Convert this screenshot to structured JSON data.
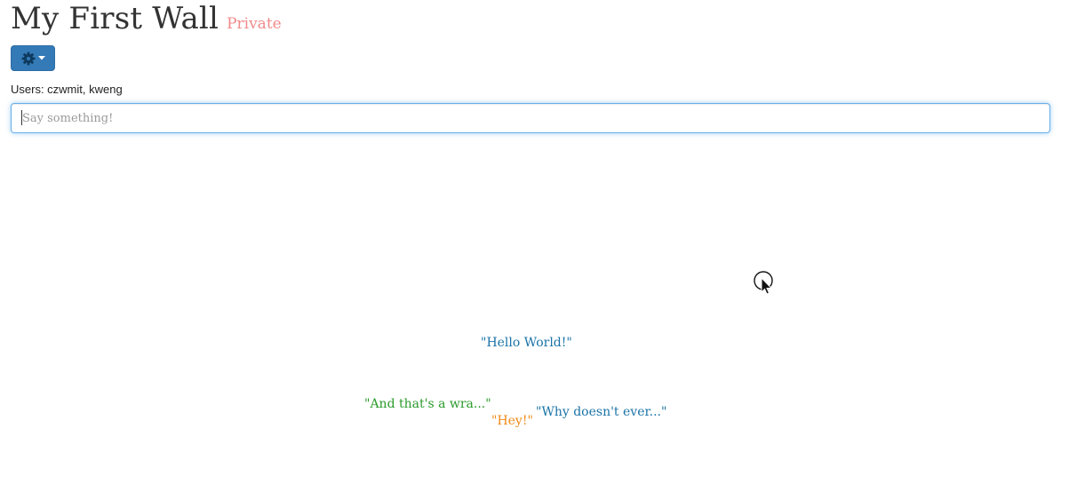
{
  "wall": {
    "title": "My First Wall",
    "privacy": "Private"
  },
  "settings_button": {
    "icon": "gear-icon",
    "dropdown_icon": "caret-down-icon"
  },
  "users": {
    "text": "Users: czwmit, kweng"
  },
  "composer": {
    "placeholder": "Say something!",
    "value": ""
  },
  "posts": [
    {
      "text": "\"Hello World!\"",
      "color": "#1a73a8"
    },
    {
      "text": "\"And that's a wra...\"",
      "color": "#2a9a2a"
    },
    {
      "text": "\"Hey!\"",
      "color": "#f08a16"
    },
    {
      "text": "\"Why doesn't ever...\"",
      "color": "#1a73a8"
    }
  ],
  "colors": {
    "privacy": "#f08a8a",
    "button": "#337ab7",
    "input_focus": "#66afe9"
  },
  "cursor": {
    "icon": "busy-pointer-icon"
  }
}
